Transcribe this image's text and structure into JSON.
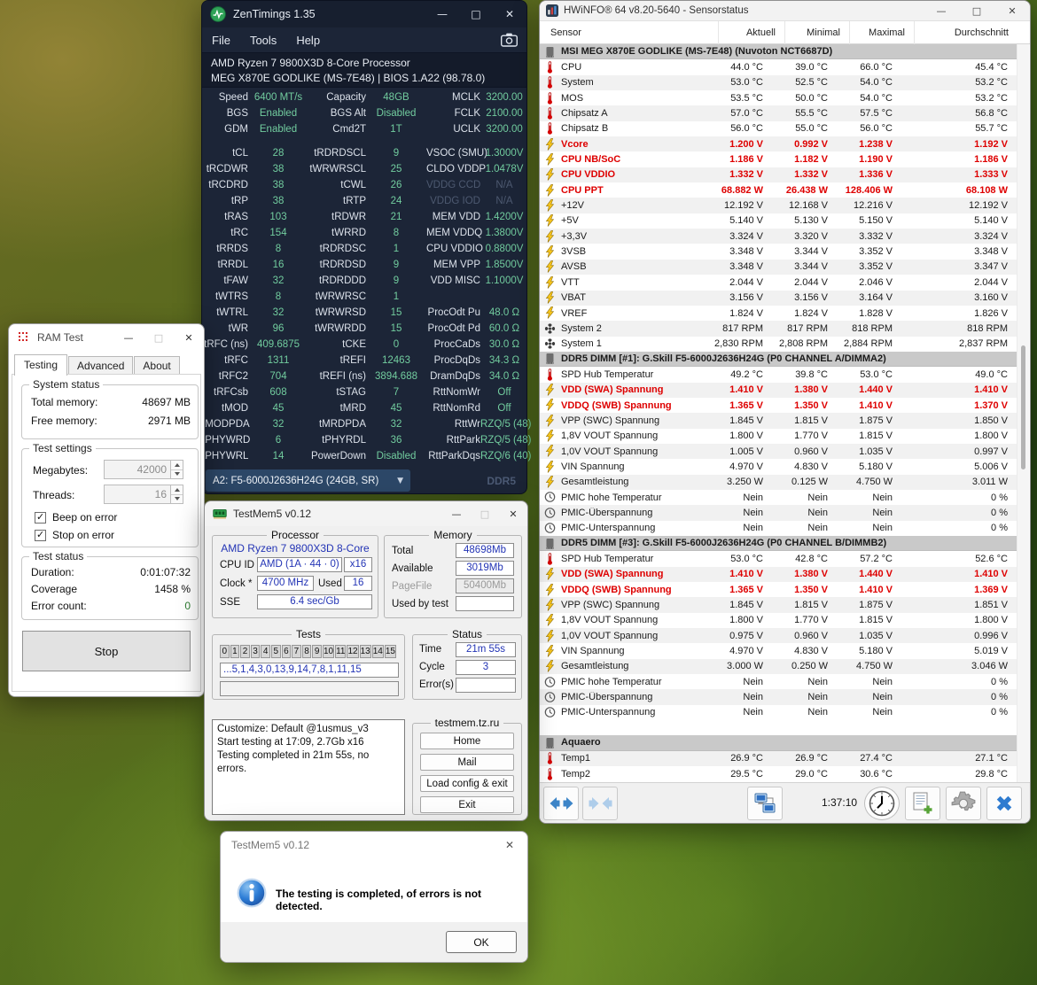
{
  "zentimings": {
    "title": "ZenTimings 1.35",
    "menu": [
      "File",
      "Tools",
      "Help"
    ],
    "info_line1": "AMD Ryzen 7 9800X3D 8-Core Processor",
    "info_line2": "MEG X870E GODLIKE (MS-7E48) | BIOS 1.A22 (98.78.0)",
    "config_rows": [
      [
        "Speed",
        "6400 MT/s",
        "Capacity",
        "48GB",
        "MCLK",
        "3200.00"
      ],
      [
        "BGS",
        "Enabled",
        "BGS Alt",
        "Disabled",
        "FCLK",
        "2100.00"
      ],
      [
        "GDM",
        "Enabled",
        "Cmd2T",
        "1T",
        "UCLK",
        "3200.00"
      ]
    ],
    "timing_rows": [
      [
        "tCL",
        "28",
        "tRDRDSCL",
        "9",
        "VSOC (SMU)",
        "1.3000V"
      ],
      [
        "tRCDWR",
        "38",
        "tWRWRSCL",
        "25",
        "CLDO VDDP",
        "1.0478V"
      ],
      [
        "tRCDRD",
        "38",
        "tCWL",
        "26",
        "VDDG CCD",
        "N/A"
      ],
      [
        "tRP",
        "38",
        "tRTP",
        "24",
        "VDDG IOD",
        "N/A"
      ],
      [
        "tRAS",
        "103",
        "tRDWR",
        "21",
        "MEM VDD",
        "1.4200V"
      ],
      [
        "tRC",
        "154",
        "tWRRD",
        "8",
        "MEM VDDQ",
        "1.3800V"
      ],
      [
        "tRRDS",
        "8",
        "tRDRDSC",
        "1",
        "CPU VDDIO",
        "0.8800V"
      ],
      [
        "tRRDL",
        "16",
        "tRDRDSD",
        "9",
        "MEM VPP",
        "1.8500V"
      ],
      [
        "tFAW",
        "32",
        "tRDRDDD",
        "9",
        "VDD MISC",
        "1.1000V"
      ],
      [
        "tWTRS",
        "8",
        "tWRWRSC",
        "1",
        "",
        ""
      ],
      [
        "tWTRL",
        "32",
        "tWRWRSD",
        "15",
        "ProcOdt Pu",
        "48.0 Ω"
      ],
      [
        "tWR",
        "96",
        "tWRWRDD",
        "15",
        "ProcOdt Pd",
        "60.0 Ω"
      ],
      [
        "tRFC (ns)",
        "409.6875",
        "tCKE",
        "0",
        "ProcCaDs",
        "30.0 Ω"
      ],
      [
        "tRFC",
        "1311",
        "tREFI",
        "12463",
        "ProcDqDs",
        "34.3 Ω"
      ],
      [
        "tRFC2",
        "704",
        "tREFI (ns)",
        "3894.688",
        "DramDqDs",
        "34.0 Ω"
      ],
      [
        "tRFCsb",
        "608",
        "tSTAG",
        "7",
        "RttNomWr",
        "Off"
      ],
      [
        "tMOD",
        "45",
        "tMRD",
        "45",
        "RttNomRd",
        "Off"
      ],
      [
        "tMODPDA",
        "32",
        "tMRDPDA",
        "32",
        "RttWr",
        "RZQ/5 (48)"
      ],
      [
        "tPHYWRD",
        "6",
        "tPHYRDL",
        "36",
        "RttPark",
        "RZQ/5 (48)"
      ],
      [
        "tPHYWRL",
        "14",
        "PowerDown",
        "Disabled",
        "RttParkDqs",
        "RZQ/6 (40)"
      ]
    ],
    "dropdown_value": "A2: F5-6000J2636H24G (24GB, SR)",
    "ddr_label": "DDR5"
  },
  "hwinfo": {
    "title": "HWiNFO® 64 v8.20-5640 - Sensorstatus",
    "columns": [
      "Sensor",
      "Aktuell",
      "Minimal",
      "Maximal",
      "Durchschnitt"
    ],
    "rows": [
      {
        "type": "section",
        "label": "MSI MEG X870E GODLIKE (MS-7E48) (Nuvoton NCT6687D)"
      },
      {
        "icon": "temperature",
        "label": "CPU",
        "v": [
          "44.0 °C",
          "39.0 °C",
          "66.0 °C",
          "45.4 °C"
        ]
      },
      {
        "icon": "temperature",
        "label": "System",
        "v": [
          "53.0 °C",
          "52.5 °C",
          "54.0 °C",
          "53.2 °C"
        ]
      },
      {
        "icon": "temperature",
        "label": "MOS",
        "v": [
          "53.5 °C",
          "50.0 °C",
          "54.0 °C",
          "53.2 °C"
        ]
      },
      {
        "icon": "temperature",
        "label": "Chipsatz A",
        "v": [
          "57.0 °C",
          "55.5 °C",
          "57.5 °C",
          "56.8 °C"
        ]
      },
      {
        "icon": "temperature",
        "label": "Chipsatz B",
        "v": [
          "56.0 °C",
          "55.0 °C",
          "56.0 °C",
          "55.7 °C"
        ]
      },
      {
        "icon": "voltage",
        "label": "Vcore",
        "alert": true,
        "v": [
          "1.200 V",
          "0.992 V",
          "1.238 V",
          "1.192 V"
        ]
      },
      {
        "icon": "voltage",
        "label": "CPU NB/SoC",
        "alert": true,
        "v": [
          "1.186 V",
          "1.182 V",
          "1.190 V",
          "1.186 V"
        ]
      },
      {
        "icon": "voltage",
        "label": "CPU VDDIO",
        "alert": true,
        "v": [
          "1.332 V",
          "1.332 V",
          "1.336 V",
          "1.333 V"
        ]
      },
      {
        "icon": "voltage",
        "label": "CPU PPT",
        "alert": true,
        "v": [
          "68.882 W",
          "26.438 W",
          "128.406 W",
          "68.108 W"
        ]
      },
      {
        "icon": "voltage",
        "label": "+12V",
        "v": [
          "12.192 V",
          "12.168 V",
          "12.216 V",
          "12.192 V"
        ]
      },
      {
        "icon": "voltage",
        "label": "+5V",
        "v": [
          "5.140 V",
          "5.130 V",
          "5.150 V",
          "5.140 V"
        ]
      },
      {
        "icon": "voltage",
        "label": "+3,3V",
        "v": [
          "3.324 V",
          "3.320 V",
          "3.332 V",
          "3.324 V"
        ]
      },
      {
        "icon": "voltage",
        "label": "3VSB",
        "v": [
          "3.348 V",
          "3.344 V",
          "3.352 V",
          "3.348 V"
        ]
      },
      {
        "icon": "voltage",
        "label": "AVSB",
        "v": [
          "3.348 V",
          "3.344 V",
          "3.352 V",
          "3.347 V"
        ]
      },
      {
        "icon": "voltage",
        "label": "VTT",
        "v": [
          "2.044 V",
          "2.044 V",
          "2.046 V",
          "2.044 V"
        ]
      },
      {
        "icon": "voltage",
        "label": "VBAT",
        "v": [
          "3.156 V",
          "3.156 V",
          "3.164 V",
          "3.160 V"
        ]
      },
      {
        "icon": "voltage",
        "label": "VREF",
        "v": [
          "1.824 V",
          "1.824 V",
          "1.828 V",
          "1.826 V"
        ]
      },
      {
        "icon": "fan",
        "label": "System 2",
        "v": [
          "817 RPM",
          "817 RPM",
          "818 RPM",
          "818 RPM"
        ]
      },
      {
        "icon": "fan",
        "label": "System 1",
        "v": [
          "2,830 RPM",
          "2,808 RPM",
          "2,884 RPM",
          "2,837 RPM"
        ]
      },
      {
        "type": "section",
        "label": "DDR5 DIMM [#1]: G.Skill F5-6000J2636H24G (P0 CHANNEL A/DIMMA2)"
      },
      {
        "icon": "temperature",
        "label": "SPD Hub Temperatur",
        "v": [
          "49.2 °C",
          "39.8 °C",
          "53.0 °C",
          "49.0 °C"
        ]
      },
      {
        "icon": "voltage",
        "label": "VDD (SWA) Spannung",
        "alert": true,
        "v": [
          "1.410 V",
          "1.380 V",
          "1.440 V",
          "1.410 V"
        ]
      },
      {
        "icon": "voltage",
        "label": "VDDQ (SWB) Spannung",
        "alert": true,
        "v": [
          "1.365 V",
          "1.350 V",
          "1.410 V",
          "1.370 V"
        ]
      },
      {
        "icon": "voltage",
        "label": "VPP (SWC) Spannung",
        "v": [
          "1.845 V",
          "1.815 V",
          "1.875 V",
          "1.850 V"
        ]
      },
      {
        "icon": "voltage",
        "label": "1,8V VOUT Spannung",
        "v": [
          "1.800 V",
          "1.770 V",
          "1.815 V",
          "1.800 V"
        ]
      },
      {
        "icon": "voltage",
        "label": "1,0V VOUT Spannung",
        "v": [
          "1.005 V",
          "0.960 V",
          "1.035 V",
          "0.997 V"
        ]
      },
      {
        "icon": "voltage",
        "label": "VIN Spannung",
        "v": [
          "4.970 V",
          "4.830 V",
          "5.180 V",
          "5.006 V"
        ]
      },
      {
        "icon": "voltage",
        "label": "Gesamtleistung",
        "v": [
          "3.250 W",
          "0.125 W",
          "4.750 W",
          "3.011 W"
        ]
      },
      {
        "icon": "clock",
        "label": "PMIC hohe Temperatur",
        "v": [
          "Nein",
          "Nein",
          "Nein",
          "0 %"
        ]
      },
      {
        "icon": "clock",
        "label": "PMIC-Überspannung",
        "v": [
          "Nein",
          "Nein",
          "Nein",
          "0 %"
        ]
      },
      {
        "icon": "clock",
        "label": "PMIC-Unterspannung",
        "v": [
          "Nein",
          "Nein",
          "Nein",
          "0 %"
        ]
      },
      {
        "type": "section",
        "label": "DDR5 DIMM [#3]: G.Skill F5-6000J2636H24G (P0 CHANNEL B/DIMMB2)"
      },
      {
        "icon": "temperature",
        "label": "SPD Hub Temperatur",
        "v": [
          "53.0 °C",
          "42.8 °C",
          "57.2 °C",
          "52.6 °C"
        ]
      },
      {
        "icon": "voltage",
        "label": "VDD (SWA) Spannung",
        "alert": true,
        "v": [
          "1.410 V",
          "1.380 V",
          "1.440 V",
          "1.410 V"
        ]
      },
      {
        "icon": "voltage",
        "label": "VDDQ (SWB) Spannung",
        "alert": true,
        "v": [
          "1.365 V",
          "1.350 V",
          "1.410 V",
          "1.369 V"
        ]
      },
      {
        "icon": "voltage",
        "label": "VPP (SWC) Spannung",
        "v": [
          "1.845 V",
          "1.815 V",
          "1.875 V",
          "1.851 V"
        ]
      },
      {
        "icon": "voltage",
        "label": "1,8V VOUT Spannung",
        "v": [
          "1.800 V",
          "1.770 V",
          "1.815 V",
          "1.800 V"
        ]
      },
      {
        "icon": "voltage",
        "label": "1,0V VOUT Spannung",
        "v": [
          "0.975 V",
          "0.960 V",
          "1.035 V",
          "0.996 V"
        ]
      },
      {
        "icon": "voltage",
        "label": "VIN Spannung",
        "v": [
          "4.970 V",
          "4.830 V",
          "5.180 V",
          "5.019 V"
        ]
      },
      {
        "icon": "voltage",
        "label": "Gesamtleistung",
        "v": [
          "3.000 W",
          "0.250 W",
          "4.750 W",
          "3.046 W"
        ]
      },
      {
        "icon": "clock",
        "label": "PMIC hohe Temperatur",
        "v": [
          "Nein",
          "Nein",
          "Nein",
          "0 %"
        ]
      },
      {
        "icon": "clock",
        "label": "PMIC-Überspannung",
        "v": [
          "Nein",
          "Nein",
          "Nein",
          "0 %"
        ]
      },
      {
        "icon": "clock",
        "label": "PMIC-Unterspannung",
        "v": [
          "Nein",
          "Nein",
          "Nein",
          "0 %"
        ]
      },
      {
        "type": "blank"
      },
      {
        "type": "section",
        "label": "Aquaero"
      },
      {
        "icon": "temperature",
        "label": "Temp1",
        "v": [
          "26.9 °C",
          "26.9 °C",
          "27.4 °C",
          "27.1 °C"
        ]
      },
      {
        "icon": "temperature",
        "label": "Temp2",
        "v": [
          "29.5 °C",
          "29.0 °C",
          "30.6 °C",
          "29.8 °C"
        ]
      }
    ],
    "toolbar": {
      "time": "1:37:10"
    }
  },
  "ramtest": {
    "title": "RAM Test",
    "tabs": [
      "Testing",
      "Advanced",
      "About"
    ],
    "system_status": {
      "legend": "System status",
      "rows": [
        [
          "Total memory:",
          "48697 MB"
        ],
        [
          "Free memory:",
          "2971 MB"
        ]
      ]
    },
    "test_settings": {
      "legend": "Test settings",
      "megabytes_label": "Megabytes:",
      "megabytes": "42000",
      "threads_label": "Threads:",
      "threads": "16",
      "checkboxes": [
        "Beep on error",
        "Stop on error"
      ]
    },
    "test_status": {
      "legend": "Test status",
      "rows": [
        [
          "Duration:",
          "0:01:07:32"
        ],
        [
          "Coverage",
          "1458 %"
        ],
        [
          "Error count:",
          "0"
        ]
      ]
    },
    "stop_label": "Stop"
  },
  "testmem5": {
    "title": "TestMem5 v0.12",
    "processor": {
      "legend": "Processor",
      "name": "AMD Ryzen 7 9800X3D 8-Core",
      "cpu_id_label": "CPU ID",
      "cpu_id": "AMD  (1A · 44 · 0)",
      "cpu_multiplier": "x16",
      "clock_label": "Clock *",
      "clock": "4700 MHz",
      "used_label": "Used",
      "used": "16",
      "sse_label": "SSE",
      "sse": "6.4 sec/Gb"
    },
    "memory": {
      "legend": "Memory",
      "total_label": "Total",
      "total": "48698Mb",
      "available_label": "Available",
      "available": "3019Mb",
      "pagefile_label": "PageFile",
      "pagefile": "50400Mb",
      "used_by_test_label": "Used by test",
      "used_by_test": ""
    },
    "tests": {
      "legend": "Tests",
      "buttons": [
        "0",
        "1",
        "2",
        "3",
        "4",
        "5",
        "6",
        "7",
        "8",
        "9",
        "10",
        "11",
        "12",
        "13",
        "14",
        "15"
      ],
      "sequence": "...5,1,4,3,0,13,9,14,7,8,1,11,15",
      "current": ""
    },
    "status": {
      "legend": "Status",
      "time_label": "Time",
      "time": "21m 55s",
      "cycle_label": "Cycle",
      "cycle": "3",
      "errors_label": "Error(s)",
      "errors": ""
    },
    "log": [
      "Customize: Default @1usmus_v3",
      "Start testing at 17:09, 2.7Gb x16",
      "Testing completed in 21m 55s, no errors."
    ],
    "links": {
      "legend": "testmem.tz.ru",
      "buttons": [
        "Home",
        "Mail",
        "Load config & exit",
        "Exit"
      ]
    }
  },
  "dialog": {
    "title": "TestMem5 v0.12",
    "message": "The testing is completed, of errors is not detected.",
    "ok_label": "OK"
  }
}
